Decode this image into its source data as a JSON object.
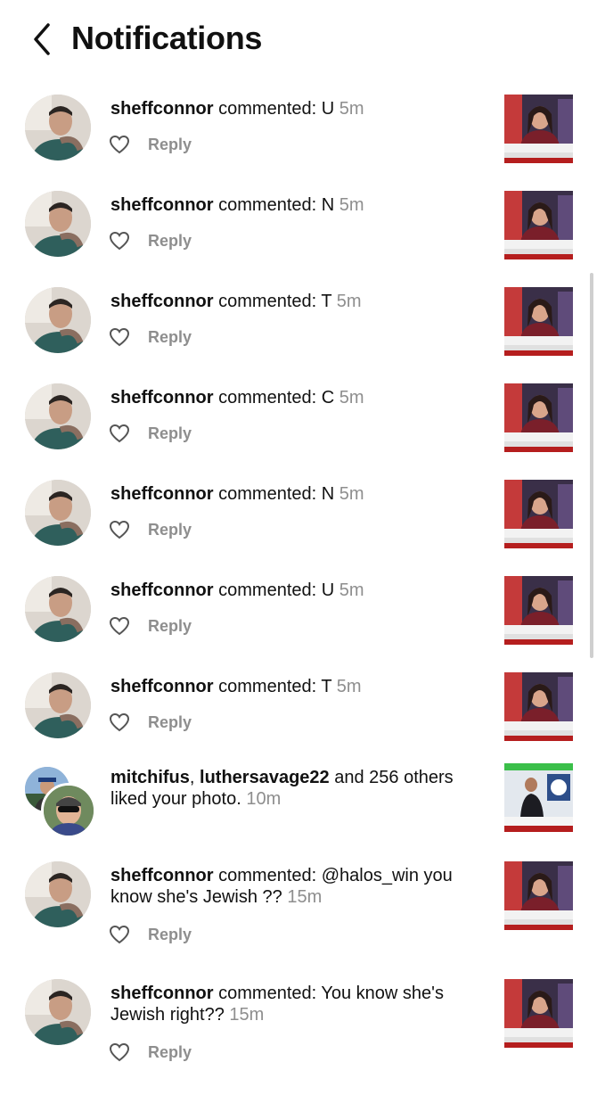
{
  "header": {
    "title": "Notifications"
  },
  "notifications": [
    {
      "user": "sheffconnor",
      "text": "commented: U",
      "time": "5m",
      "reply": "Reply"
    },
    {
      "user": "sheffconnor",
      "text": "commented: N",
      "time": "5m",
      "reply": "Reply"
    },
    {
      "user": "sheffconnor",
      "text": "commented: T",
      "time": "5m",
      "reply": "Reply"
    },
    {
      "user": "sheffconnor",
      "text": "commented: C",
      "time": "5m",
      "reply": "Reply"
    },
    {
      "user": "sheffconnor",
      "text": "commented: N",
      "time": "5m",
      "reply": "Reply"
    },
    {
      "user": "sheffconnor",
      "text": "commented: U",
      "time": "5m",
      "reply": "Reply"
    },
    {
      "user": "sheffconnor",
      "text": "commented: T",
      "time": "5m",
      "reply": "Reply"
    },
    {
      "user1": "mitchifus",
      "sep": ", ",
      "user2": "luthersavage22",
      "text": " and 256 others liked your photo.",
      "time": "10m"
    },
    {
      "user": "sheffconnor",
      "text": "commented: @halos_win you know she's Jewish ??",
      "time": "15m",
      "reply": "Reply"
    },
    {
      "user": "sheffconnor",
      "text": "commented: You know she's Jewish right??",
      "time": "15m",
      "reply": "Reply"
    }
  ]
}
